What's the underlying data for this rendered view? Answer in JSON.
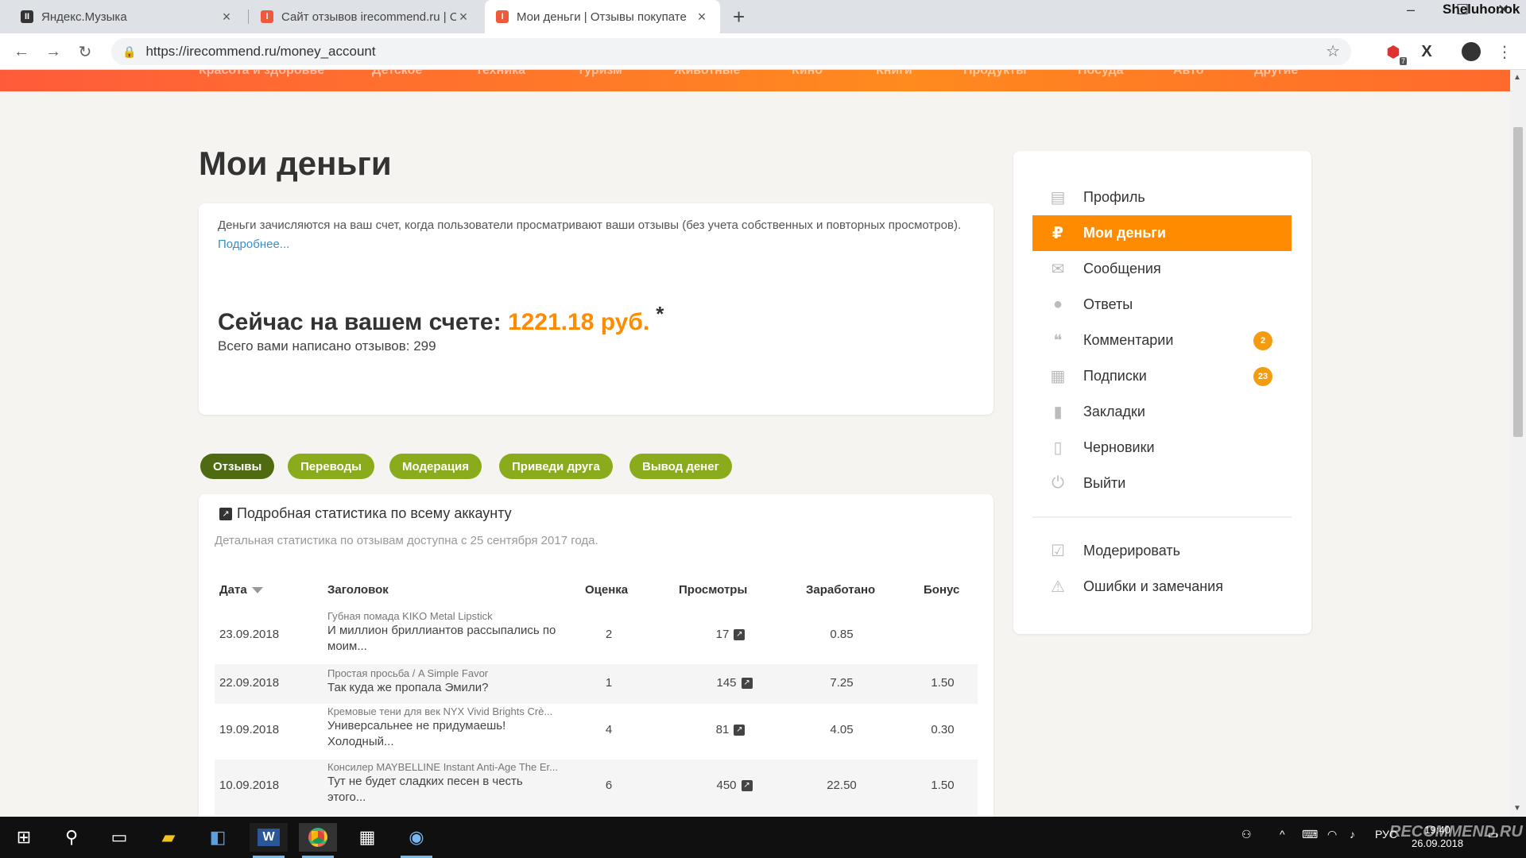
{
  "browser": {
    "tabs": [
      {
        "title": "Яндекс.Музыка",
        "active": false
      },
      {
        "title": "Сайт отзывов irecommend.ru | О",
        "active": false
      },
      {
        "title": "Мои деньги | Отзывы покупате",
        "active": true
      }
    ],
    "user_label": "Sheluhonok",
    "url": "https://irecommend.ru/money_account",
    "extension_badge": "7"
  },
  "site_nav": {
    "items": [
      "Красота и здоровье",
      "Детское",
      "Техника",
      "Туризм",
      "Животные",
      "Кино",
      "Книги",
      "Продукты",
      "Посуда",
      "Авто",
      "Другие"
    ]
  },
  "page": {
    "title": "Мои деньги",
    "info": {
      "text": "Деньги зачисляются на ваш счет, когда пользователи просматривают ваши отзывы (без учета собственных и повторных просмотров).",
      "more_link": "Подробнее..."
    },
    "balance": {
      "label": "Сейчас на вашем счете:",
      "amount": "1221.18 руб.",
      "asterisk": "*"
    },
    "total_reviews": "Всего вами написано отзывов: 299"
  },
  "pills": [
    {
      "label": "Отзывы",
      "active": true
    },
    {
      "label": "Переводы",
      "active": false
    },
    {
      "label": "Модерация",
      "active": false
    },
    {
      "label": "Приведи друга",
      "active": false
    },
    {
      "label": "Вывод денег",
      "active": false
    }
  ],
  "stats": {
    "header": "Подробная статистика по всему аккаунту",
    "note": "Детальная статистика по отзывам доступна с 25 сентября 2017 года.",
    "columns": [
      "Дата",
      "Заголовок",
      "Оценка",
      "Просмотры",
      "Заработано",
      "Бонус"
    ],
    "rows": [
      {
        "date": "23.09.2018",
        "product": "Губная помада KIKO Metal Lipstick",
        "title": "И миллион бриллиантов рассыпались по моим...",
        "rating": "2",
        "views": "17",
        "earned": "0.85",
        "bonus": ""
      },
      {
        "date": "22.09.2018",
        "product": "Простая просьба / A Simple Favor",
        "title": "Так куда же пропала Эмили?",
        "rating": "1",
        "views": "145",
        "earned": "7.25",
        "bonus": "1.50"
      },
      {
        "date": "19.09.2018",
        "product": "Кремовые тени для век NYX Vivid Brights Crè...",
        "title": "Универсальнее не придумаешь! Холодный...",
        "rating": "4",
        "views": "81",
        "earned": "4.05",
        "bonus": "0.30"
      },
      {
        "date": "10.09.2018",
        "product": "Консилер MAYBELLINE Instant Anti-Age The Er...",
        "title": "Тут не будет сладких песен в честь этого...",
        "rating": "6",
        "views": "450",
        "earned": "22.50",
        "bonus": "1.50"
      }
    ]
  },
  "sidebar": {
    "items": [
      {
        "label": "Профиль",
        "icon": "profile-card-icon",
        "badge": ""
      },
      {
        "label": "Мои деньги",
        "icon": "ruble-icon",
        "badge": "",
        "active": true
      },
      {
        "label": "Сообщения",
        "icon": "envelope-icon",
        "badge": ""
      },
      {
        "label": "Ответы",
        "icon": "speech-bubble-icon",
        "badge": ""
      },
      {
        "label": "Комментарии",
        "icon": "comments-icon",
        "badge": "2"
      },
      {
        "label": "Подписки",
        "icon": "subscriptions-icon",
        "badge": "23"
      },
      {
        "label": "Закладки",
        "icon": "bookmark-icon",
        "badge": ""
      },
      {
        "label": "Черновики",
        "icon": "draft-icon",
        "badge": ""
      },
      {
        "label": "Выйти",
        "icon": "power-icon",
        "badge": ""
      }
    ],
    "extra_items": [
      {
        "label": "Модерировать",
        "icon": "moderate-check-icon"
      },
      {
        "label": "Ошибки и замечания",
        "icon": "warning-icon"
      }
    ]
  },
  "taskbar": {
    "language": "РУС",
    "time": "19:40",
    "date": "26.09.2018",
    "watermark": "RECOMMEND.RU"
  },
  "colors": {
    "accent": "#ff8c00",
    "pill_green": "#8aac1c",
    "pill_green_active": "#4e6b12",
    "badge": "#f39c12",
    "link": "#3a8fc8"
  }
}
